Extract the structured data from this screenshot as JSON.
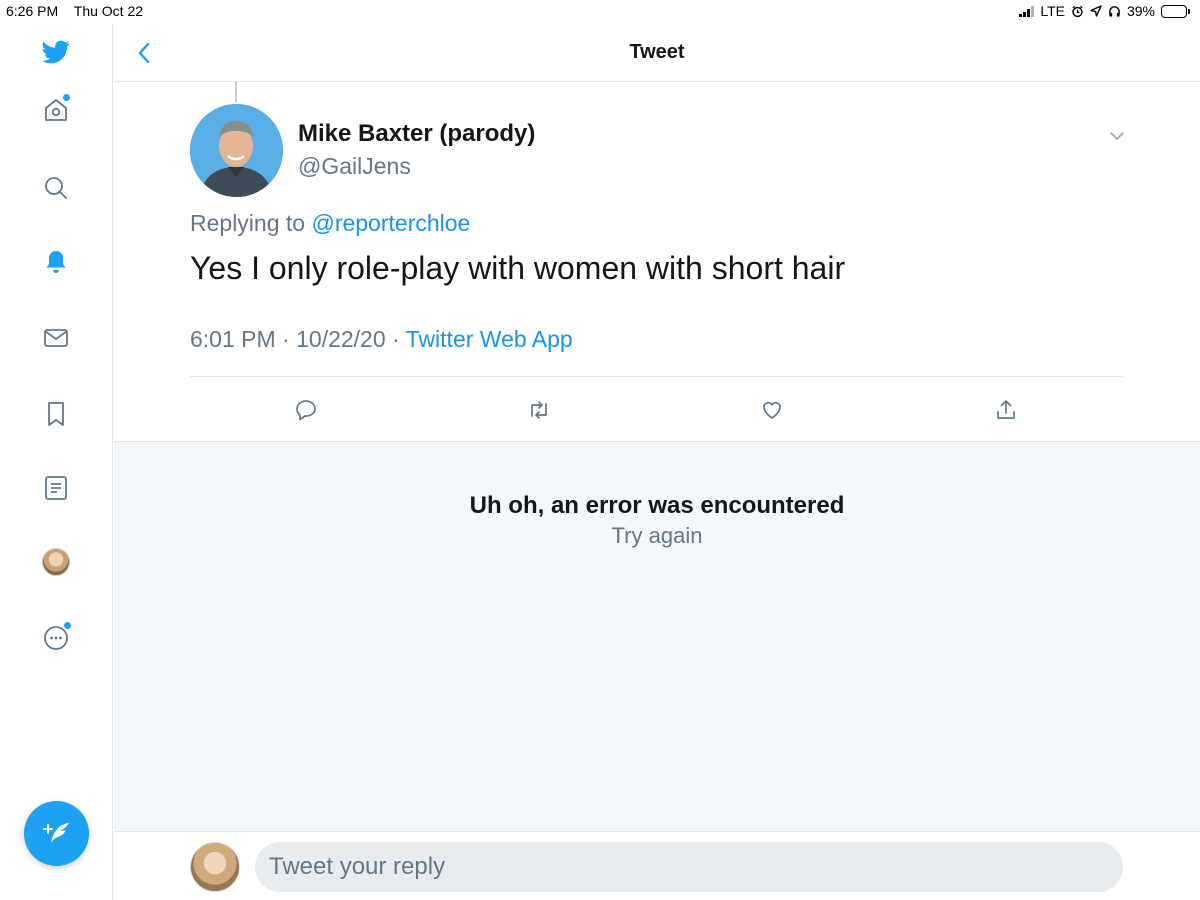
{
  "status_bar": {
    "time": "6:26 PM",
    "date": "Thu Oct 22",
    "network": "LTE",
    "battery": "39%",
    "battery_level": 0.39
  },
  "sidebar": {
    "items": [
      {
        "name": "twitter-logo-icon"
      },
      {
        "name": "home-icon",
        "has_dot": true
      },
      {
        "name": "search-icon"
      },
      {
        "name": "notifications-icon"
      },
      {
        "name": "messages-icon"
      },
      {
        "name": "bookmarks-icon"
      },
      {
        "name": "lists-icon"
      },
      {
        "name": "profile-avatar"
      },
      {
        "name": "more-icon",
        "has_dot": true
      }
    ],
    "compose_icon": "compose-tweet-icon"
  },
  "header": {
    "title": "Tweet",
    "back_icon": "chevron-left-icon"
  },
  "tweet": {
    "author_name": "Mike Baxter (parody)",
    "author_handle": "@GailJens",
    "replying_prefix": "Replying to",
    "replying_to": "@reporterchloe",
    "text": "Yes I only role-play with women with short hair",
    "time": "6:01 PM",
    "date": "10/22/20",
    "source": "Twitter Web App",
    "separator": " · "
  },
  "actions": [
    {
      "name": "reply-icon"
    },
    {
      "name": "retweet-icon"
    },
    {
      "name": "like-icon"
    },
    {
      "name": "share-icon"
    }
  ],
  "error": {
    "title": "Uh oh, an error was encountered",
    "retry": "Try again"
  },
  "reply": {
    "placeholder": "Tweet your reply"
  },
  "colors": {
    "accent": "#1da1f2",
    "link": "#1b95e0",
    "secondary_text": "#657786",
    "error_bg": "#f5f8fa"
  }
}
